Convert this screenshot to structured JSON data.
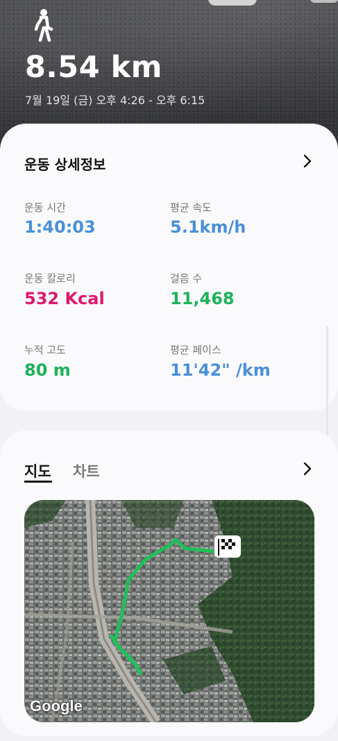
{
  "header": {
    "distance": "8.54 km",
    "date_range": "7월 19일 (금) 오후 4:26 - 오후 6:15",
    "activity_icon": "walk-icon"
  },
  "details": {
    "title": "운동 상세정보",
    "metrics": [
      {
        "label": "운동 시간",
        "value": "1:40:03"
      },
      {
        "label": "평균 속도",
        "value": "5.1km/h"
      },
      {
        "label": "운동 칼로리",
        "value": "532 Kcal"
      },
      {
        "label": "걸음 수",
        "value": "11,468"
      },
      {
        "label": "누적 고도",
        "value": "80 m"
      },
      {
        "label": "평균 페이스",
        "value": "11'42\" /km"
      }
    ],
    "colors": {
      "blue": "#4a90d9",
      "pink": "#e0176e",
      "green": "#1db35a"
    }
  },
  "map_section": {
    "tabs": [
      {
        "label": "지도",
        "active": true
      },
      {
        "label": "차트",
        "active": false
      }
    ],
    "map_attribution": "Google",
    "route_color": "#1fbf5a"
  }
}
